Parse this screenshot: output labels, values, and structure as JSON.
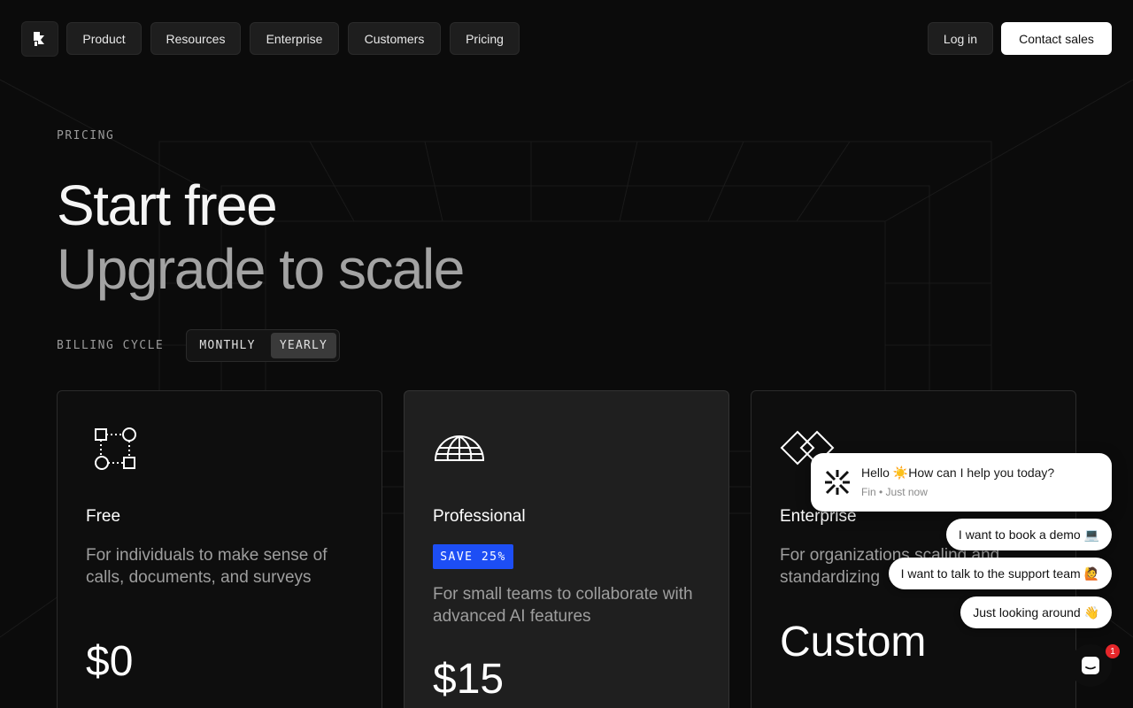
{
  "nav": {
    "logo_icon": "brand-logo-icon",
    "items": [
      {
        "label": "Product"
      },
      {
        "label": "Resources"
      },
      {
        "label": "Enterprise"
      },
      {
        "label": "Customers"
      },
      {
        "label": "Pricing"
      }
    ],
    "login_label": "Log in",
    "contact_label": "Contact sales"
  },
  "hero": {
    "eyebrow": "PRICING",
    "title_line1": "Start free",
    "title_line2": "Upgrade to scale"
  },
  "billing": {
    "label": "BILLING CYCLE",
    "options": [
      {
        "label": "MONTHLY",
        "selected": false
      },
      {
        "label": "YEARLY",
        "selected": true
      }
    ]
  },
  "plans": [
    {
      "icon": "nodes-icon",
      "title": "Free",
      "description": "For individuals to make sense of calls, documents, and surveys",
      "price": "$0"
    },
    {
      "icon": "globe-icon",
      "title": "Professional",
      "badge": "SAVE 25%",
      "description": "For small teams to collaborate with advanced AI features",
      "price": "$15"
    },
    {
      "icon": "diamonds-icon",
      "title": "Enterprise",
      "description": "For organizations scaling and standardizing",
      "price": "Custom"
    }
  ],
  "chat": {
    "message": "Hello ☀️How can I help you today?",
    "meta": "Fin • Just now",
    "replies": [
      {
        "label": "I want to book a demo 💻"
      },
      {
        "label": "I want to talk to the support team 🙋"
      },
      {
        "label": "Just looking around 👋"
      }
    ],
    "launcher_icon": "chat-icon",
    "notification_count": "1"
  },
  "colors": {
    "background": "#0b0b0b",
    "badge": "#1d4ef5",
    "notification": "#e5262a"
  }
}
